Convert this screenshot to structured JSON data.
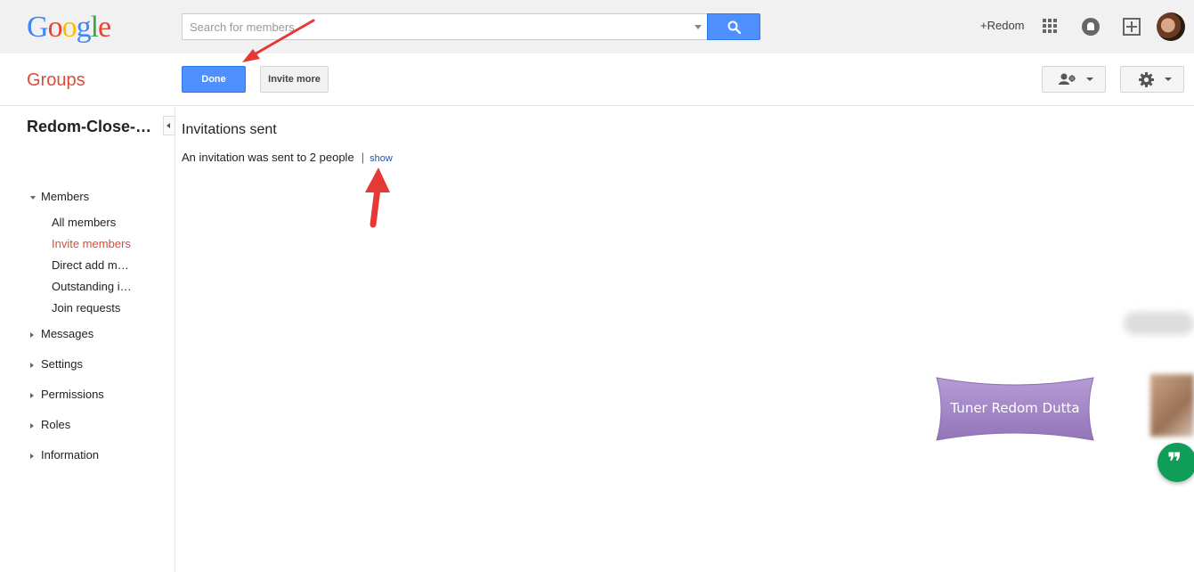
{
  "header": {
    "logo_letters": [
      "G",
      "o",
      "o",
      "g",
      "l",
      "e"
    ],
    "search_placeholder": "Search for members",
    "user_link": "+Redom",
    "icons": [
      "search-icon",
      "apps-grid-icon",
      "notifications-icon",
      "share-plus-icon",
      "avatar"
    ]
  },
  "toolbar": {
    "app_title": "Groups",
    "done_label": "Done",
    "invite_more_label": "Invite more",
    "icons": [
      "add-member-icon",
      "gear-icon"
    ]
  },
  "sidebar": {
    "group_name": "Redom-Close-…",
    "members_label": "Members",
    "members_items": [
      {
        "label": "All members"
      },
      {
        "label": "Invite members"
      },
      {
        "label": "Direct add m…"
      },
      {
        "label": "Outstanding i…"
      },
      {
        "label": "Join requests"
      }
    ],
    "sections": [
      {
        "label": "Messages"
      },
      {
        "label": "Settings"
      },
      {
        "label": "Permissions"
      },
      {
        "label": "Roles"
      },
      {
        "label": "Information"
      }
    ]
  },
  "main": {
    "title": "Invitations sent",
    "message": "An invitation was sent to 2 people",
    "separator": "|",
    "show_link": "show"
  },
  "overlay": {
    "watermark": "Tuner Redom Dutta",
    "hangout_glyph": "❞"
  },
  "colors": {
    "accent_blue": "#4d90fe",
    "groups_red": "#dd4b39",
    "link_blue": "#1155cc",
    "hangout_green": "#0f9d58",
    "annotation_arrow": "#e53935",
    "ribbon_purple": "#a78bc8"
  }
}
